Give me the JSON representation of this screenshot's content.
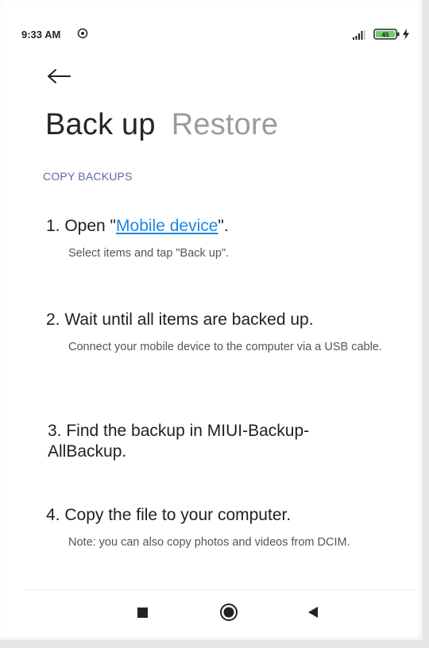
{
  "status_bar": {
    "time": "9:33 AM",
    "battery_level": "45",
    "icons": [
      "sync-icon",
      "signal-icon",
      "battery-icon",
      "charging-icon"
    ]
  },
  "header": {
    "back_icon": "arrow-left-icon",
    "tabs": [
      {
        "label": "Back up",
        "active": true
      },
      {
        "label": "Restore",
        "active": false
      }
    ]
  },
  "section": {
    "title": "COPY BACKUPS"
  },
  "steps": [
    {
      "title_prefix": "1. Open \"",
      "link_text": "Mobile device",
      "title_suffix": "\".",
      "description": "Select items and tap \"Back up\"."
    },
    {
      "title": "2. Wait until all items are backed up.",
      "description": "Connect your mobile device to the computer via a USB cable."
    },
    {
      "title": "3. Find the backup in MIUI-Backup-AllBackup."
    },
    {
      "title": "4. Copy the file to your computer.",
      "description": "Note: you can also copy photos and videos from DCIM."
    }
  ],
  "nav_bar": {
    "icons": [
      "recent-apps-icon",
      "home-icon",
      "back-triangle-icon"
    ]
  },
  "colors": {
    "accent": "#5969a7",
    "link": "#1b87e5",
    "text": "#1f1f1f",
    "inactive_tab": "#9b9b9b"
  }
}
